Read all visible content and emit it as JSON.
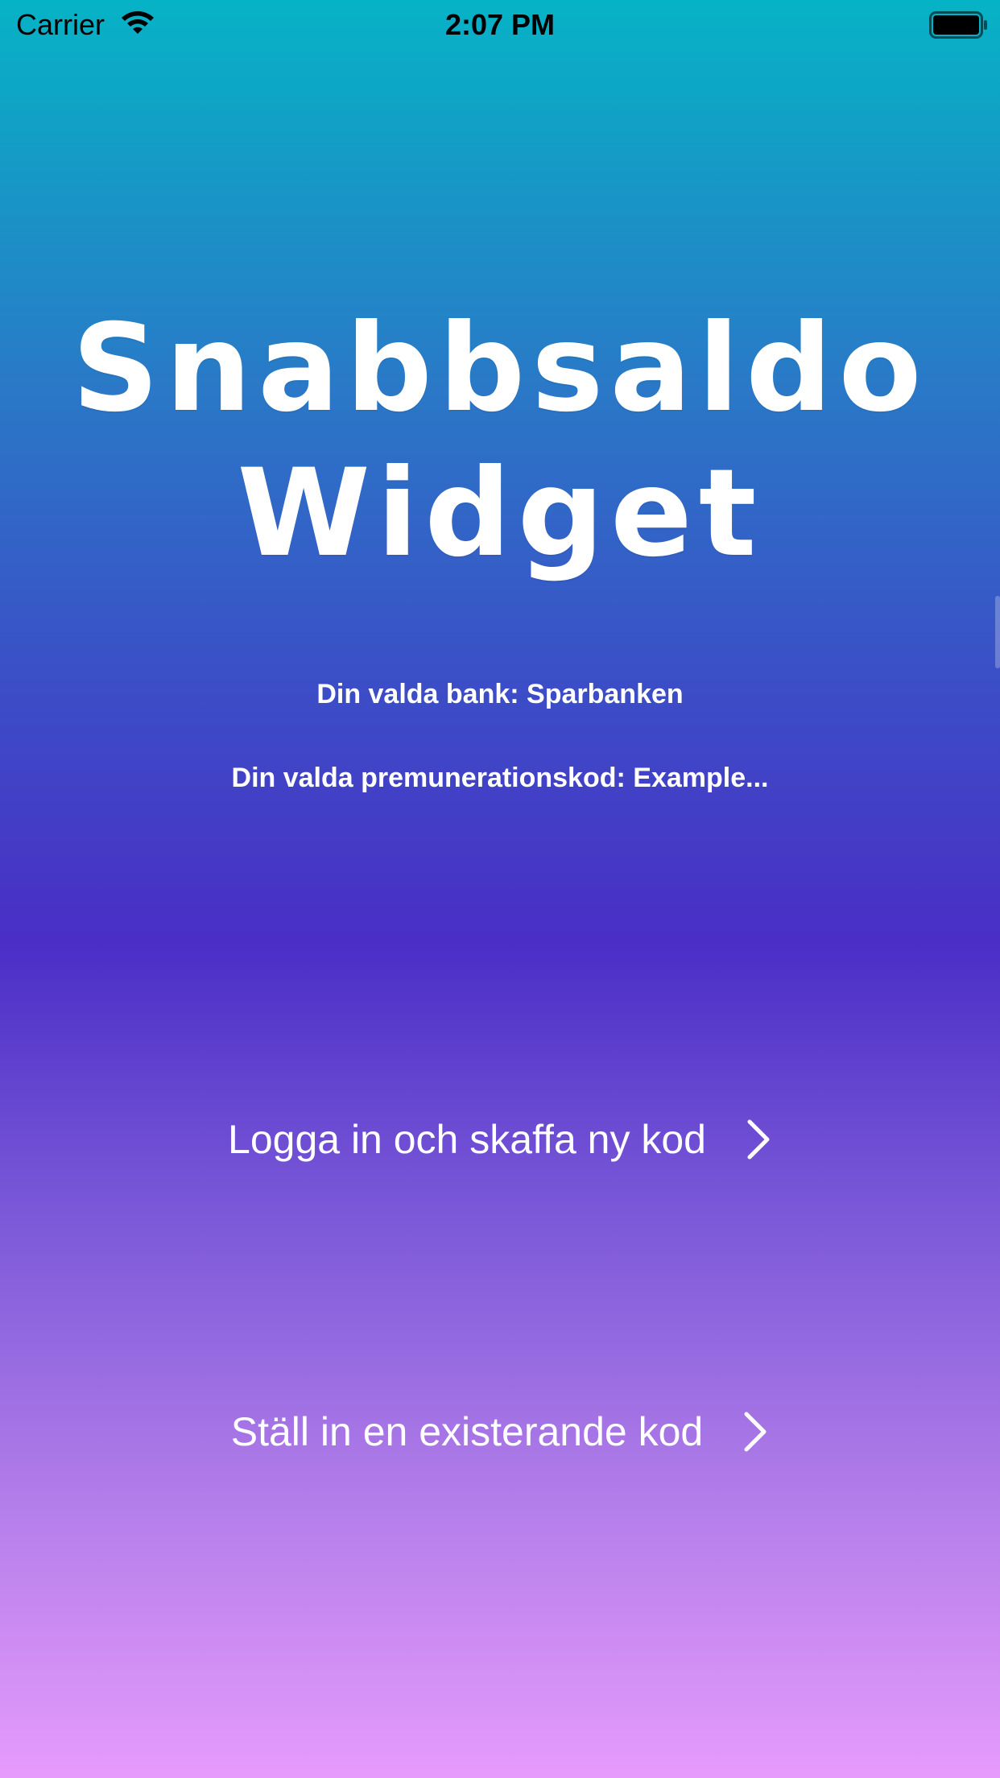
{
  "status_bar": {
    "carrier": "Carrier",
    "time": "2:07 PM",
    "icons": [
      "wifi-icon",
      "battery-icon"
    ]
  },
  "app": {
    "title_line1": "Snabbsaldo",
    "title_line2": "Widget"
  },
  "info": {
    "bank": "Din valda bank: Sparbanken",
    "code": "Din valda premunerationskod: Example..."
  },
  "actions": {
    "login_label": "Logga in och skaffa ny kod",
    "existing_label": "Ställ in en existerande kod",
    "chevron_icon": "chevron-right-icon"
  },
  "colors": {
    "gradient_top": "#06b3c6",
    "gradient_mid": "#4a2ec6",
    "gradient_bottom": "#e69bfc",
    "text": "#ffffff"
  }
}
